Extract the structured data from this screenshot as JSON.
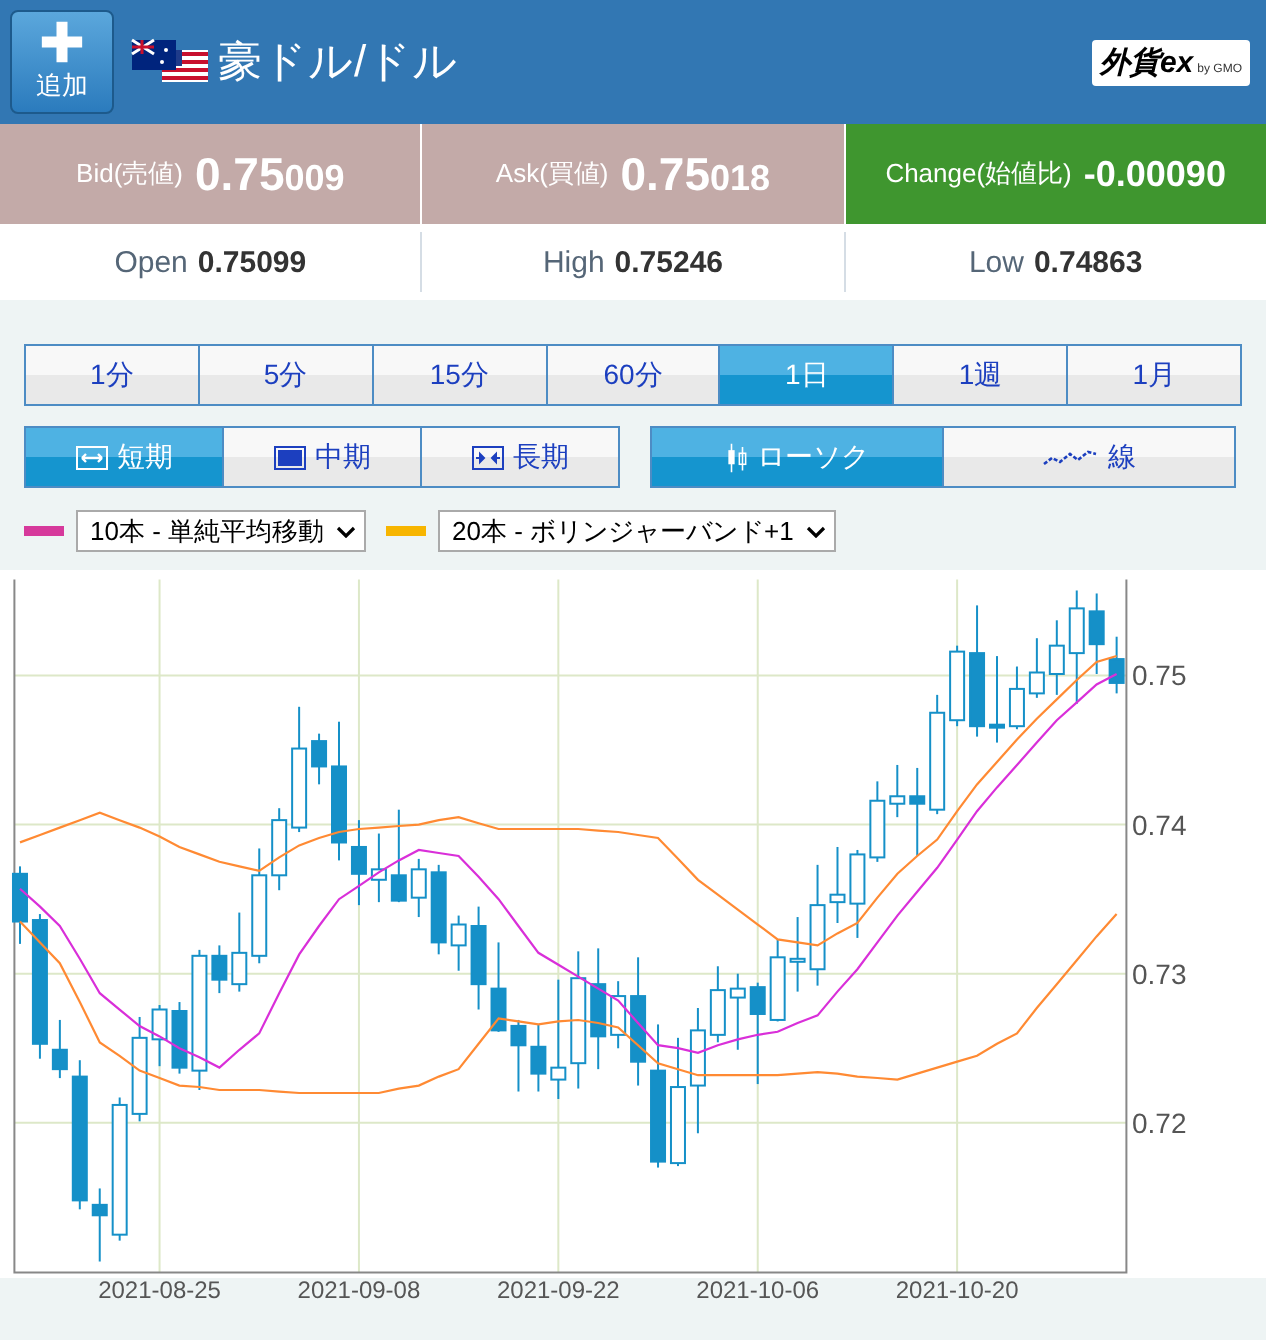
{
  "header": {
    "add_button": "追加",
    "pair": "豪ドル/ドル",
    "logo": {
      "brand": "外貨ex",
      "by": "by GMO"
    }
  },
  "quotes": [
    {
      "kind": "bid",
      "label": "Bid(売値)",
      "major": "0.75",
      "minor": "009"
    },
    {
      "kind": "ask",
      "label": "Ask(買値)",
      "major": "0.75",
      "minor": "018"
    },
    {
      "kind": "change",
      "label": "Change(始値比)",
      "value": "-0.00090"
    }
  ],
  "stats": [
    {
      "label": "Open",
      "value": "0.75099"
    },
    {
      "label": "High",
      "value": "0.75246"
    },
    {
      "label": "Low",
      "value": "0.74863"
    }
  ],
  "timeframes": [
    {
      "label": "1分",
      "selected": false
    },
    {
      "label": "5分",
      "selected": false
    },
    {
      "label": "15分",
      "selected": false
    },
    {
      "label": "60分",
      "selected": false
    },
    {
      "label": "1日",
      "selected": true
    },
    {
      "label": "1週",
      "selected": false
    },
    {
      "label": "1月",
      "selected": false
    }
  ],
  "ranges": [
    {
      "kind": "short",
      "label": "短期",
      "selected": true
    },
    {
      "kind": "medium",
      "label": "中期",
      "selected": false
    },
    {
      "kind": "long",
      "label": "長期",
      "selected": false
    }
  ],
  "styles": [
    {
      "kind": "candle",
      "label": "ローソク",
      "selected": true
    },
    {
      "kind": "line",
      "label": "線",
      "selected": false
    }
  ],
  "indicators": [
    {
      "color": "#d6399b",
      "value": "10本 - 単純平均移動"
    },
    {
      "color": "#f7b500",
      "value": "20本 - ボリンジャーバンド+1"
    }
  ],
  "chart": {
    "chart_data": {
      "type": "candlestick",
      "categories": [
        null,
        null,
        null,
        null,
        null,
        null,
        null,
        "2021-08-25",
        null,
        null,
        null,
        null,
        null,
        null,
        null,
        null,
        null,
        "2021-09-08",
        null,
        null,
        null,
        null,
        null,
        null,
        null,
        null,
        null,
        "2021-09-22",
        null,
        null,
        null,
        null,
        null,
        null,
        null,
        null,
        null,
        "2021-10-06",
        null,
        null,
        null,
        null,
        null,
        null,
        null,
        null,
        null,
        "2021-10-20",
        null,
        null,
        null,
        null,
        null,
        null,
        null,
        null
      ],
      "ylim": [
        0.70997,
        0.75643
      ],
      "grid": true,
      "yticks": [
        0.72,
        0.73,
        0.74,
        0.75
      ],
      "ohlc": [
        [
          0.7367,
          0.7372,
          0.732,
          0.7335
        ],
        [
          0.7336,
          0.734,
          0.7243,
          0.7253
        ],
        [
          0.7249,
          0.7269,
          0.723,
          0.7236
        ],
        [
          0.7231,
          0.7242,
          0.7142,
          0.7148
        ],
        [
          0.7145,
          0.7156,
          0.7107,
          0.7138
        ],
        [
          0.7125,
          0.7217,
          0.7121,
          0.7212
        ],
        [
          0.7206,
          0.7271,
          0.7201,
          0.7257
        ],
        [
          0.7256,
          0.7279,
          0.7238,
          0.7276
        ],
        [
          0.7275,
          0.7281,
          0.7233,
          0.7237
        ],
        [
          0.7235,
          0.7316,
          0.7222,
          0.7312
        ],
        [
          0.7312,
          0.7319,
          0.7287,
          0.7296
        ],
        [
          0.7293,
          0.7341,
          0.7288,
          0.7314
        ],
        [
          0.7312,
          0.7384,
          0.7307,
          0.7366
        ],
        [
          0.7366,
          0.7411,
          0.7356,
          0.7403
        ],
        [
          0.7398,
          0.7479,
          0.7395,
          0.7451
        ],
        [
          0.7456,
          0.7461,
          0.7427,
          0.7439
        ],
        [
          0.7439,
          0.7469,
          0.7376,
          0.7388
        ],
        [
          0.7385,
          0.7403,
          0.7346,
          0.7367
        ],
        [
          0.7363,
          0.7394,
          0.7348,
          0.737
        ],
        [
          0.7366,
          0.741,
          0.7348,
          0.7349
        ],
        [
          0.7351,
          0.7377,
          0.7338,
          0.737
        ],
        [
          0.7368,
          0.7373,
          0.7313,
          0.7321
        ],
        [
          0.7319,
          0.7339,
          0.7302,
          0.7333
        ],
        [
          0.7332,
          0.7345,
          0.7276,
          0.7293
        ],
        [
          0.729,
          0.7321,
          0.7261,
          0.7262
        ],
        [
          0.7265,
          0.7269,
          0.7221,
          0.7252
        ],
        [
          0.7251,
          0.7266,
          0.7221,
          0.7233
        ],
        [
          0.7229,
          0.7296,
          0.7216,
          0.7237
        ],
        [
          0.724,
          0.7315,
          0.7223,
          0.7297
        ],
        [
          0.7293,
          0.7317,
          0.7236,
          0.7258
        ],
        [
          0.7259,
          0.7295,
          0.725,
          0.7285
        ],
        [
          0.7285,
          0.7311,
          0.7225,
          0.7241
        ],
        [
          0.7235,
          0.7266,
          0.717,
          0.7174
        ],
        [
          0.7173,
          0.7257,
          0.7171,
          0.7224
        ],
        [
          0.7225,
          0.7277,
          0.7193,
          0.7262
        ],
        [
          0.7259,
          0.7305,
          0.7254,
          0.7289
        ],
        [
          0.7284,
          0.73,
          0.7249,
          0.729
        ],
        [
          0.7291,
          0.7294,
          0.7226,
          0.7273
        ],
        [
          0.7269,
          0.7323,
          0.7268,
          0.7311
        ],
        [
          0.7308,
          0.7338,
          0.7288,
          0.731
        ],
        [
          0.7303,
          0.7373,
          0.7292,
          0.7346
        ],
        [
          0.7348,
          0.7385,
          0.7334,
          0.7353
        ],
        [
          0.7347,
          0.7383,
          0.7324,
          0.738
        ],
        [
          0.7378,
          0.7429,
          0.7375,
          0.7416
        ],
        [
          0.7414,
          0.744,
          0.7405,
          0.7419
        ],
        [
          0.7419,
          0.7438,
          0.7379,
          0.7414
        ],
        [
          0.741,
          0.7487,
          0.7407,
          0.7475
        ],
        [
          0.747,
          0.752,
          0.7466,
          0.7516
        ],
        [
          0.7515,
          0.7547,
          0.7459,
          0.7466
        ],
        [
          0.7467,
          0.7513,
          0.7455,
          0.7465
        ],
        [
          0.7466,
          0.7506,
          0.7464,
          0.7491
        ],
        [
          0.7488,
          0.7525,
          0.7485,
          0.7502
        ],
        [
          0.7501,
          0.7537,
          0.7487,
          0.752
        ],
        [
          0.7515,
          0.7557,
          0.7481,
          0.7545
        ],
        [
          0.7543,
          0.7555,
          0.7501,
          0.7521
        ],
        [
          0.7511,
          0.7526,
          0.7488,
          0.7495
        ]
      ],
      "series": [
        {
          "type": "line",
          "color": "#d92fd9",
          "values": [
            0.7357,
            0.7345,
            0.7332,
            0.731,
            0.7287,
            0.7276,
            0.7265,
            0.7258,
            0.725,
            0.7244,
            0.7237,
            0.7249,
            0.726,
            0.7287,
            0.7313,
            0.7332,
            0.735,
            0.7359,
            0.7368,
            0.7376,
            0.7383,
            0.7381,
            0.7379,
            0.7365,
            0.735,
            0.7332,
            0.7314,
            0.7306,
            0.7298,
            0.729,
            0.7282,
            0.7267,
            0.7252,
            0.725,
            0.7247,
            0.7252,
            0.7256,
            0.7259,
            0.7261,
            0.7267,
            0.7272,
            0.7288,
            0.7303,
            0.7321,
            0.7339,
            0.7355,
            0.7371,
            0.739,
            0.7409,
            0.7425,
            0.744,
            0.7455,
            0.747,
            0.7482,
            0.7494,
            0.7501
          ]
        },
        {
          "type": "line",
          "color": "#ff8a33",
          "values": [
            0.7388,
            0.7393,
            0.7398,
            0.7403,
            0.7408,
            0.7403,
            0.7398,
            0.7392,
            0.7385,
            0.738,
            0.7375,
            0.7372,
            0.7369,
            0.7378,
            0.7386,
            0.7391,
            0.7395,
            0.7397,
            0.7398,
            0.7399,
            0.74,
            0.7403,
            0.7405,
            0.7401,
            0.7397,
            0.7397,
            0.7397,
            0.7397,
            0.7397,
            0.7396,
            0.7395,
            0.7393,
            0.7391,
            0.7377,
            0.7363,
            0.7353,
            0.7343,
            0.7333,
            0.7323,
            0.7321,
            0.7319,
            0.7327,
            0.7334,
            0.7351,
            0.7367,
            0.7379,
            0.739,
            0.7409,
            0.7427,
            0.7442,
            0.7457,
            0.7471,
            0.7484,
            0.7497,
            0.7509,
            0.7513
          ]
        },
        {
          "type": "line",
          "color": "#ff8a33",
          "values": [
            0.7335,
            0.7321,
            0.7307,
            0.7281,
            0.7254,
            0.7245,
            0.7235,
            0.723,
            0.7225,
            0.7224,
            0.7222,
            0.7222,
            0.7222,
            0.7221,
            0.722,
            0.722,
            0.722,
            0.722,
            0.722,
            0.7223,
            0.7225,
            0.7231,
            0.7236,
            0.7253,
            0.727,
            0.7268,
            0.7266,
            0.7268,
            0.7269,
            0.7267,
            0.7264,
            0.7252,
            0.724,
            0.7236,
            0.7232,
            0.7232,
            0.7232,
            0.7232,
            0.7232,
            0.7233,
            0.7234,
            0.7233,
            0.7231,
            0.723,
            0.7229,
            0.7233,
            0.7237,
            0.7241,
            0.7245,
            0.7253,
            0.726,
            0.7277,
            0.7293,
            0.7309,
            0.7325,
            0.734
          ]
        }
      ]
    }
  }
}
